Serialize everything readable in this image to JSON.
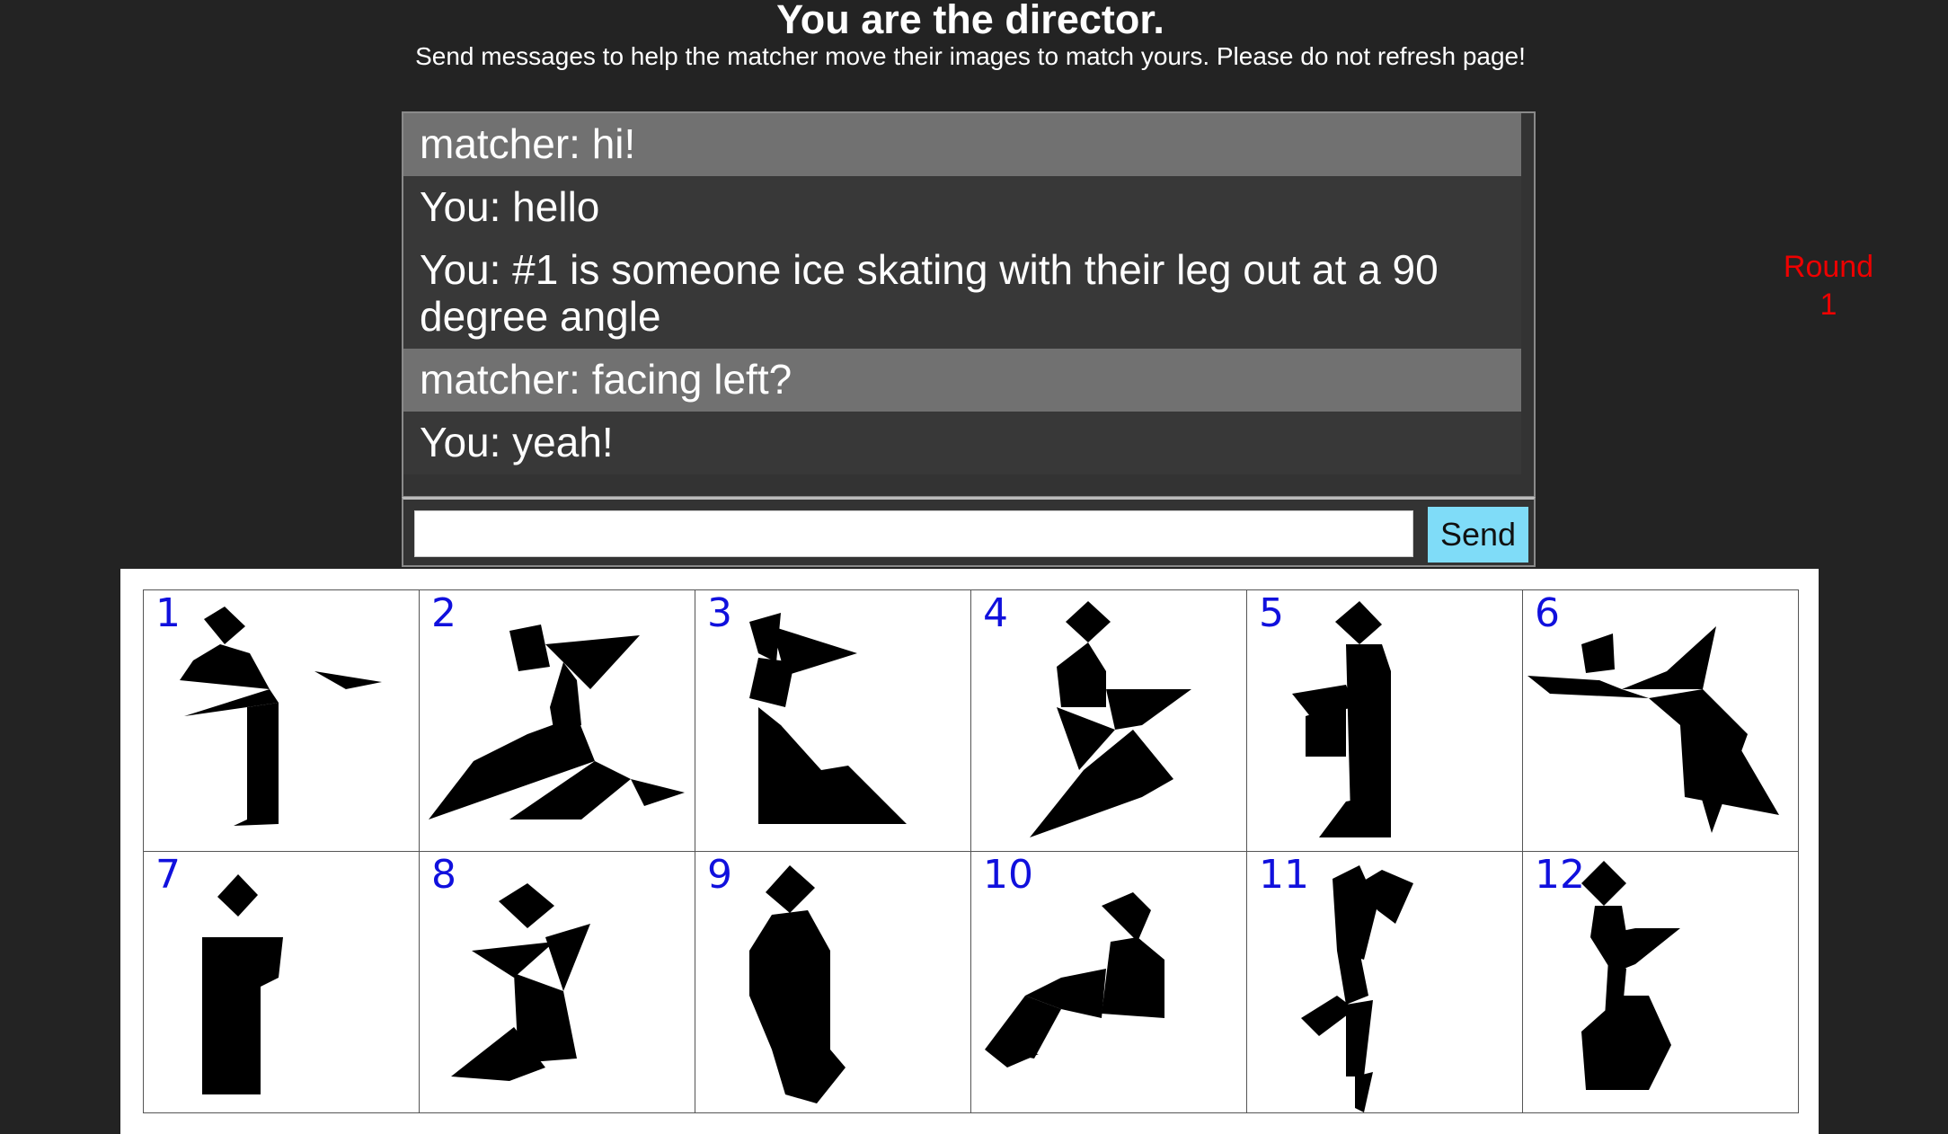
{
  "header": {
    "title": "You are the director.",
    "subtitle": "Send messages to help the matcher move their images to match yours. Please do not refresh page!"
  },
  "chat": {
    "messages": [
      {
        "sender": "matcher",
        "text": "matcher: hi!"
      },
      {
        "sender": "you",
        "text": "You: hello"
      },
      {
        "sender": "you",
        "text": "You: #1 is someone ice skating with their leg out at a 90 degree angle"
      },
      {
        "sender": "matcher",
        "text": "matcher: facing left?"
      },
      {
        "sender": "you",
        "text": "You: yeah!"
      }
    ],
    "input_value": "",
    "send_label": "Send"
  },
  "round": {
    "label": "Round",
    "number": "1"
  },
  "colors": {
    "background": "#232323",
    "matcher_row": "#717171",
    "you_row": "#383838",
    "send_button": "#7fdcf8",
    "round_text": "#ee0000",
    "tile_number": "#1010dd"
  },
  "tiles": [
    {
      "number": "1",
      "figure": "tangram-ice-skater"
    },
    {
      "number": "2",
      "figure": "tangram-kneeling-figure"
    },
    {
      "number": "3",
      "figure": "tangram-sitting-figure"
    },
    {
      "number": "4",
      "figure": "tangram-crouching-figure"
    },
    {
      "number": "5",
      "figure": "tangram-standing-figure"
    },
    {
      "number": "6",
      "figure": "tangram-flying-figure"
    },
    {
      "number": "7",
      "figure": "tangram-block-figure"
    },
    {
      "number": "8",
      "figure": "tangram-bowing-figure"
    },
    {
      "number": "9",
      "figure": "tangram-bottle-figure"
    },
    {
      "number": "10",
      "figure": "tangram-reclining-figure"
    },
    {
      "number": "11",
      "figure": "tangram-walking-figure"
    },
    {
      "number": "12",
      "figure": "tangram-seated-figure"
    }
  ]
}
